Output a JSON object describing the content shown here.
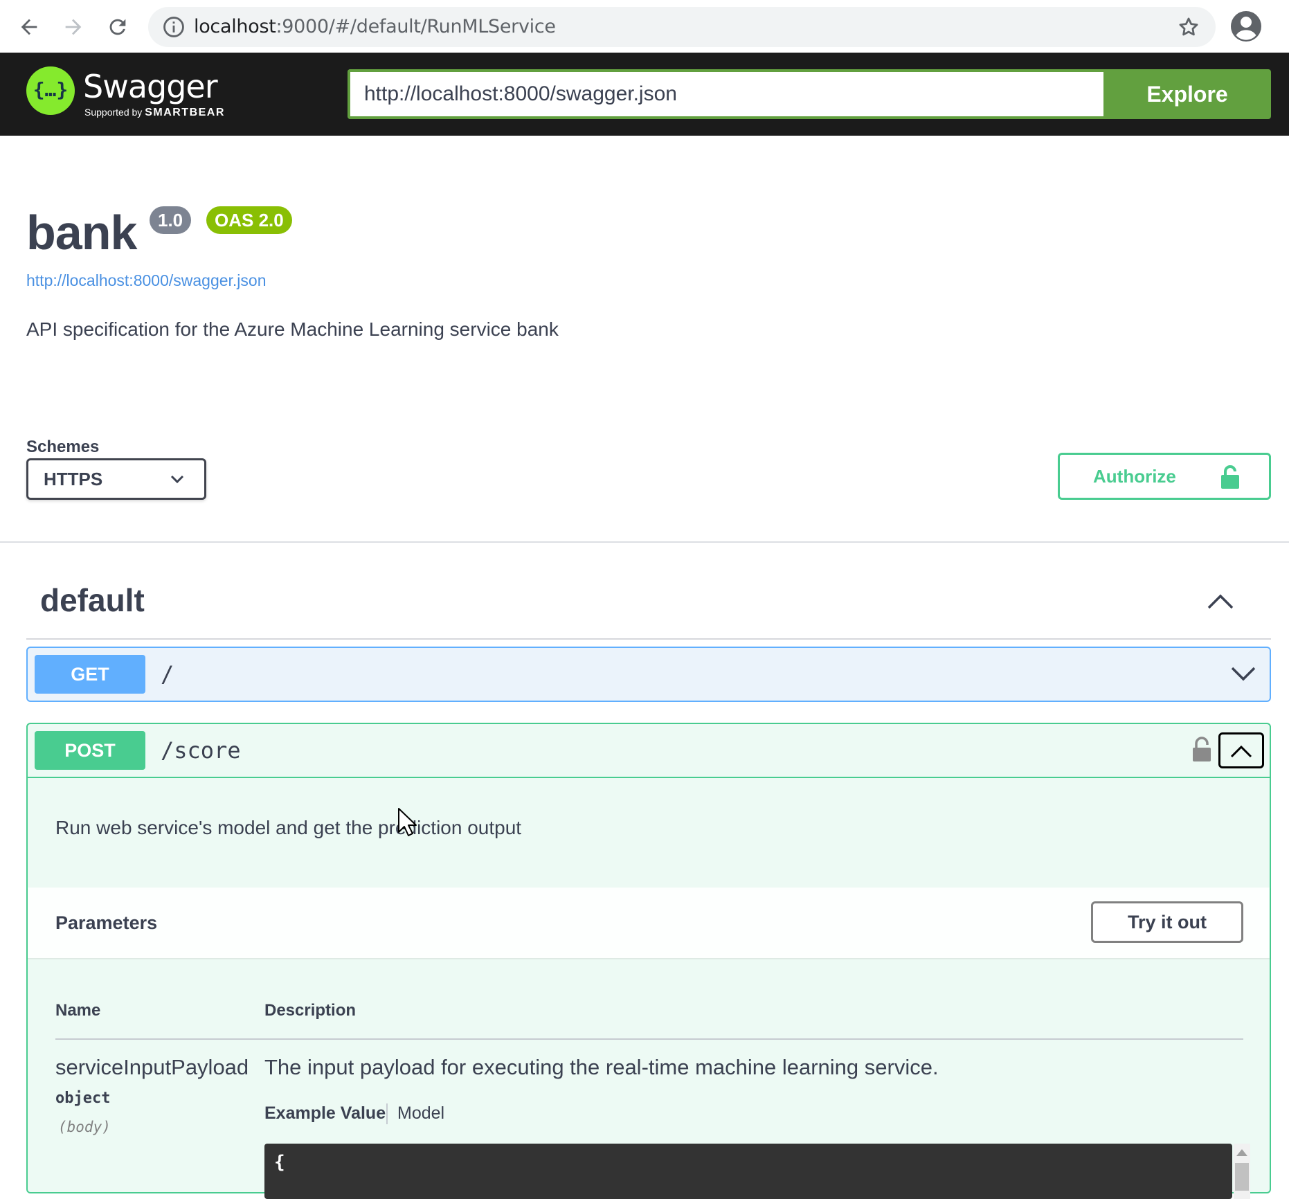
{
  "browser": {
    "url_host": "localhost",
    "url_rest": ":9000/#/default/RunMLService",
    "icons": [
      "back-arrow-icon",
      "forward-arrow-icon",
      "reload-icon",
      "info-icon",
      "star-icon",
      "profile-icon"
    ]
  },
  "topbar": {
    "logo_title": "Swagger",
    "logo_sub_prefix": "Supported by",
    "logo_sub_brand": "SMARTBEAR",
    "logo_glyph": "{…}",
    "spec_url": "http://localhost:8000/swagger.json",
    "explore_label": "Explore"
  },
  "info": {
    "title": "bank",
    "version": "1.0",
    "oas": "OAS 2.0",
    "link": "http://localhost:8000/swagger.json",
    "description": "API specification for the Azure Machine Learning service bank"
  },
  "schemes": {
    "label": "Schemes",
    "selected": "HTTPS"
  },
  "authorize": {
    "label": "Authorize"
  },
  "tag": {
    "name": "default"
  },
  "operations": [
    {
      "method": "GET",
      "path": "/"
    },
    {
      "method": "POST",
      "path": "/score",
      "summary": "Run web service's model and get the prediction output",
      "parameters_title": "Parameters",
      "try_label": "Try it out",
      "columns": {
        "name": "Name",
        "description": "Description"
      },
      "param": {
        "name": "serviceInputPayload",
        "type": "object",
        "in": "(body)",
        "description": "The input payload for executing the real-time machine learning service.",
        "tab_example": "Example Value",
        "tab_model": "Model",
        "code_first_line": "{"
      }
    }
  ],
  "colors": {
    "get": "#61affe",
    "post": "#49cc90",
    "explore": "#62a03f",
    "oas_badge": "#89bf04",
    "version_badge": "#7d8492",
    "topbar": "#1b1b1b"
  }
}
